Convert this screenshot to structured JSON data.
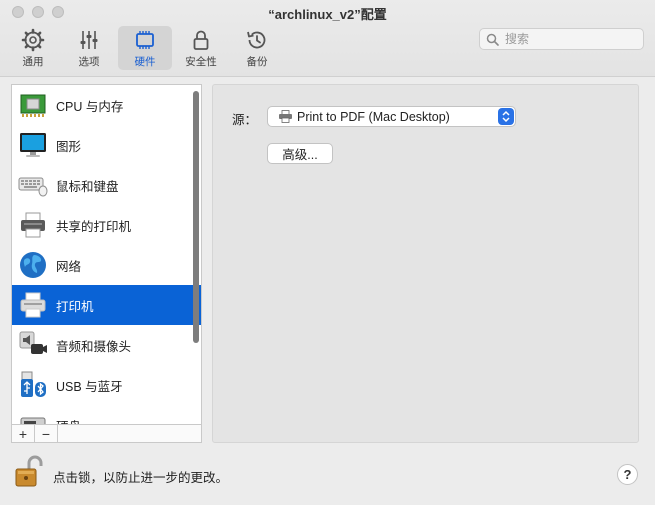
{
  "window": {
    "title": "“archlinux_v2”配置"
  },
  "toolbar": {
    "items": [
      {
        "label": "通用",
        "icon": "gear-icon"
      },
      {
        "label": "选项",
        "icon": "sliders-icon"
      },
      {
        "label": "硬件",
        "icon": "chip-icon",
        "active": true
      },
      {
        "label": "安全性",
        "icon": "lock-icon"
      },
      {
        "label": "备份",
        "icon": "history-icon"
      }
    ]
  },
  "search": {
    "placeholder": "搜索"
  },
  "sidebar": {
    "items": [
      {
        "label": "CPU 与内存",
        "icon": "cpu-memory-icon"
      },
      {
        "label": "图形",
        "icon": "monitor-icon"
      },
      {
        "label": "鼠标和键盘",
        "icon": "keyboard-icon"
      },
      {
        "label": "共享的打印机",
        "icon": "shared-printer-icon"
      },
      {
        "label": "网络",
        "icon": "globe-icon"
      },
      {
        "label": "打印机",
        "icon": "printer-icon",
        "selected": true
      },
      {
        "label": "音频和摄像头",
        "icon": "audio-camera-icon"
      },
      {
        "label": "USB 与蓝牙",
        "icon": "usb-bluetooth-icon"
      },
      {
        "label": "硬盘",
        "icon": "hard-disk-icon"
      }
    ],
    "add_label": "+",
    "remove_label": "−"
  },
  "panel": {
    "source_label": "源：",
    "source_value": "Print to PDF (Mac Desktop)",
    "advanced_label": "高级..."
  },
  "footer": {
    "lock_text": "点击锁，以防止进一步的更改。",
    "help_label": "?"
  },
  "colors": {
    "accent": "#0a63d6",
    "select_arrow": "#2a72e6",
    "active_toolbar_label": "#1a5fd1"
  }
}
